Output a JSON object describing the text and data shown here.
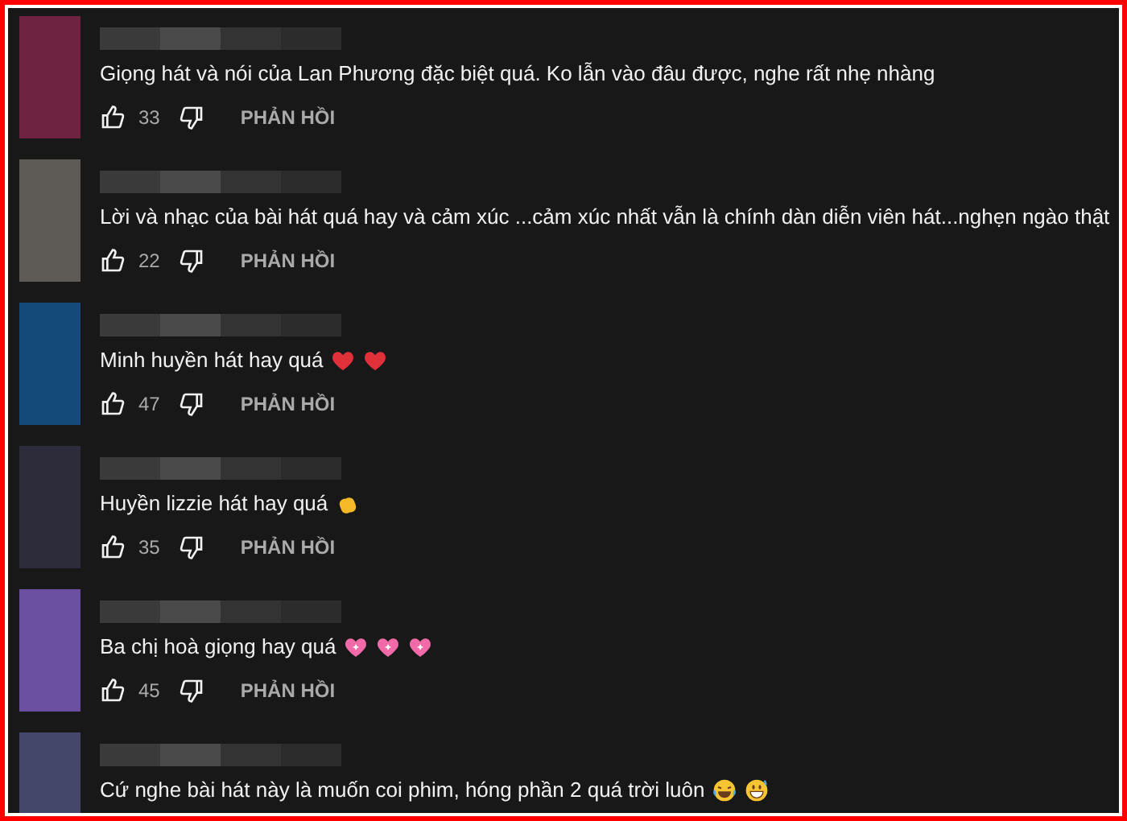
{
  "comments": [
    {
      "color": "#6e2440",
      "text": "Giọng hát và nói của Lan Phương đặc biệt quá. Ko lẫn vào đâu được, nghe rất nhẹ nhàng",
      "likes": "33",
      "reply": "PHẢN HỒI"
    },
    {
      "color": "#5e5a56",
      "text": "Lời và nhạc của bài hát quá hay và cảm xúc ...cảm xúc nhất vẫn là chính dàn diễn viên hát...nghẹn ngào thật",
      "likes": "22",
      "reply": "PHẢN HỒI"
    },
    {
      "color": "#134a7a",
      "text": "Minh huyền hát hay quá",
      "emojis": [
        {
          "kind": "heart"
        },
        {
          "kind": "heart"
        }
      ],
      "likes": "47",
      "reply": "PHẢN HỒI"
    },
    {
      "color": "#2c2c3a",
      "text": "Huyền lizzie hát hay quá",
      "emojis": [
        {
          "kind": "clap"
        }
      ],
      "likes": "35",
      "reply": "PHẢN HỒI"
    },
    {
      "color": "#6a4fa0",
      "text": "Ba chị hoà giọng hay quá",
      "emojis": [
        {
          "kind": "sparkle"
        },
        {
          "kind": "sparkle"
        },
        {
          "kind": "sparkle"
        }
      ],
      "likes": "45",
      "reply": "PHẢN HỒI"
    },
    {
      "color": "#45476a",
      "text": "Cứ nghe bài hát này là muốn coi phim, hóng phần 2 quá trời luôn",
      "emojis": [
        {
          "kind": "laugh"
        },
        {
          "kind": "grin"
        }
      ]
    }
  ]
}
